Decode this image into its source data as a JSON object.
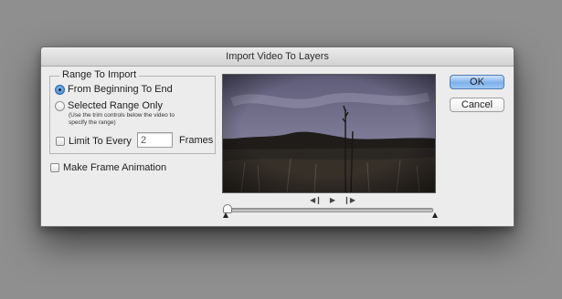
{
  "dialog": {
    "title": "Import Video To Layers"
  },
  "range_group": {
    "legend": "Range To Import",
    "option_all": {
      "label": "From Beginning To End",
      "selected": true
    },
    "option_selected": {
      "label": "Selected Range Only",
      "selected": false
    },
    "hint": "(Use the trim controls below the video to specify the range)",
    "limit_label": "Limit To Every",
    "limit_checked": false,
    "limit_value": "2",
    "frames_label": "Frames"
  },
  "make_frame_animation": {
    "label": "Make Frame Animation",
    "checked": false
  },
  "controls": {
    "prev_frame": "◀❙",
    "play": "▶",
    "next_frame": "❙▶"
  },
  "buttons": {
    "ok_label": "OK",
    "cancel_label": "Cancel"
  },
  "colors": {
    "accent": "#2f7fd2",
    "sky": "#6b6a86",
    "ground": "#2a2622"
  }
}
